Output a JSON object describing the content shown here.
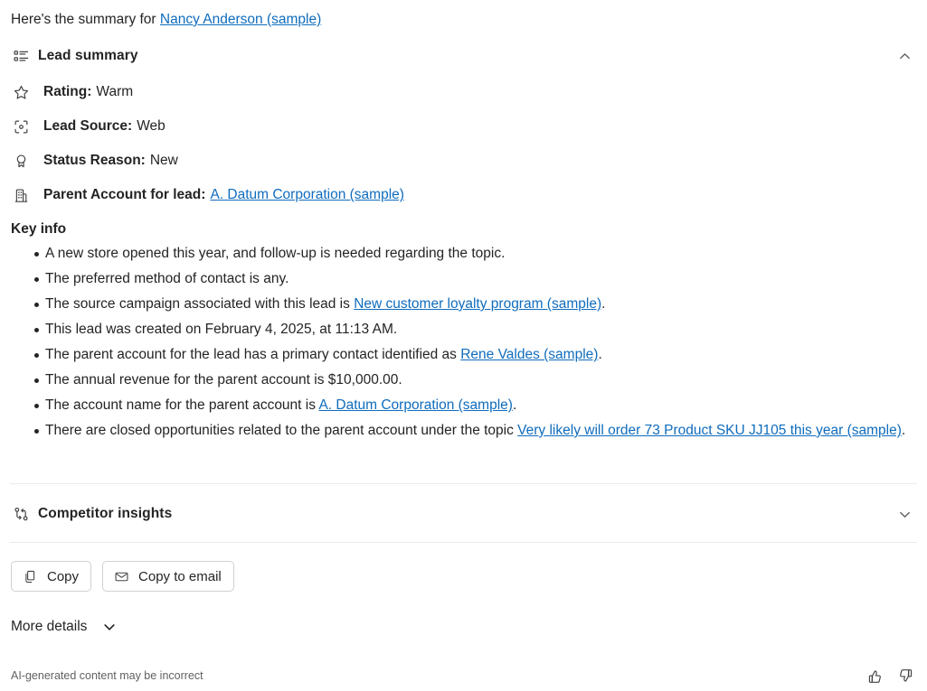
{
  "intro": {
    "prefix": "Here's the summary for ",
    "link": "Nancy Anderson (sample)"
  },
  "lead_summary": {
    "title": "Lead summary",
    "icon": "bulleted-list-icon",
    "chevron": "chevron-up-icon",
    "fields": [
      {
        "icon": "star-icon",
        "label": "Rating:",
        "value": "Warm",
        "link": null
      },
      {
        "icon": "target-icon",
        "label": "Lead Source:",
        "value": "Web",
        "link": null
      },
      {
        "icon": "ribbon-icon",
        "label": "Status Reason:",
        "value": "New",
        "link": null
      },
      {
        "icon": "building-icon",
        "label": "Parent Account for lead:",
        "value": null,
        "link": "A. Datum Corporation (sample)"
      }
    ]
  },
  "key_info": {
    "title": "Key info",
    "bullets": [
      {
        "parts": [
          {
            "t": "A new store opened this year, and follow-up is needed regarding the topic."
          }
        ]
      },
      {
        "parts": [
          {
            "t": "The preferred method of contact is any."
          }
        ]
      },
      {
        "parts": [
          {
            "t": "The source campaign associated with this lead is "
          },
          {
            "t": "New customer loyalty program (sample)",
            "link": true
          },
          {
            "t": "."
          }
        ]
      },
      {
        "parts": [
          {
            "t": "This lead was created on February 4, 2025, at 11:13 AM."
          }
        ]
      },
      {
        "parts": [
          {
            "t": "The parent account for the lead has a primary contact identified as "
          },
          {
            "t": "Rene Valdes (sample)",
            "link": true
          },
          {
            "t": "."
          }
        ]
      },
      {
        "parts": [
          {
            "t": "The annual revenue for the parent account is $10,000.00."
          }
        ]
      },
      {
        "parts": [
          {
            "t": "The account name for the parent account is "
          },
          {
            "t": "A. Datum Corporation (sample)",
            "link": true
          },
          {
            "t": "."
          }
        ]
      },
      {
        "parts": [
          {
            "t": "There are closed opportunities related to the parent account under the topic "
          },
          {
            "t": "Very likely will order 73 Product SKU JJ105 this year (sample)",
            "link": true
          },
          {
            "t": "."
          }
        ]
      }
    ]
  },
  "competitor_insights": {
    "title": "Competitor insights",
    "icon": "branch-compare-icon",
    "chevron": "chevron-down-icon"
  },
  "actions": {
    "copy_label": "Copy",
    "copy_icon": "copy-icon",
    "copy_to_email_label": "Copy to email",
    "copy_to_email_icon": "mail-icon"
  },
  "more_details": {
    "label": "More details",
    "chevron": "chevron-down-icon"
  },
  "footer": {
    "note": "AI-generated content may be incorrect",
    "thumbs_up_icon": "thumbs-up-icon",
    "thumbs_down_icon": "thumbs-down-icon"
  },
  "colors": {
    "link": "#0f6cbd",
    "text": "#242424",
    "muted": "#616161",
    "divider": "#ebebeb",
    "border": "#d1d1d1"
  }
}
